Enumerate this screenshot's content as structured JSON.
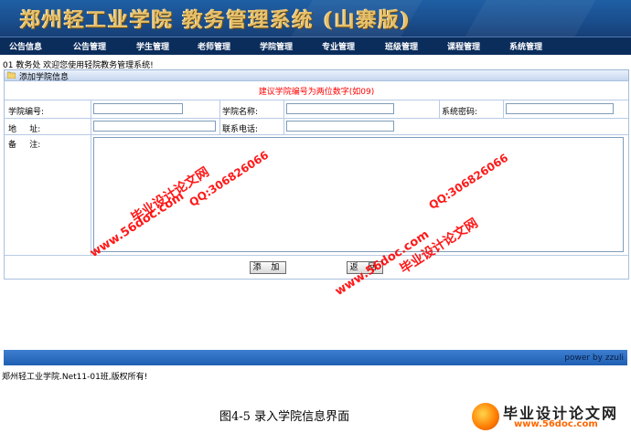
{
  "app": {
    "banner_title": "郑州轻工业学院  教务管理系统  (山寨版)"
  },
  "nav": {
    "items": [
      {
        "label": "公告信息"
      },
      {
        "label": "公告管理"
      },
      {
        "label": "学生管理"
      },
      {
        "label": "老师管理"
      },
      {
        "label": "学院管理"
      },
      {
        "label": "专业管理"
      },
      {
        "label": "班级管理"
      },
      {
        "label": "课程管理"
      },
      {
        "label": "系统管理"
      }
    ]
  },
  "welcome": "01 教务处 欢迎您使用轻院教务管理系统!",
  "section": {
    "title": "添加学院信息",
    "icon": "folder-icon"
  },
  "form": {
    "hint": "建议学院编号为两位数字(如09)",
    "college_id_label": "学院编号:",
    "college_id_value": "",
    "college_name_label": "学院名称:",
    "college_name_value": "",
    "password_label": "系统密码:",
    "password_value": "",
    "address_label": "地     址:",
    "address_value": "",
    "phone_label": "联系电话:",
    "phone_value": "",
    "remark_label": "备     注:",
    "remark_value": "",
    "add_button": "添 加",
    "back_button": "返 回"
  },
  "footer": {
    "powered_by": "power  by  zzuli",
    "copyright": "郑州轻工业学院.Net11-01班,版权所有!"
  },
  "watermarks": {
    "site_a": "毕业设计论文网",
    "qq_a": "QQ:306826066",
    "url_a": "www.56doc.com",
    "site_b": "毕业设计论文网",
    "qq_b": "QQ:306826066",
    "url_b": "www.56doc.com"
  },
  "caption": "图4-5  录入学院信息界面",
  "logo": {
    "name": "毕业设计论文网",
    "url": "www.56doc.com"
  },
  "colors": {
    "banner": "#1a4f8f",
    "nav": "#0b2d5c",
    "hint": "#ff0000",
    "watermark": "#ff0000",
    "footer_bar": "#2f6fc4"
  }
}
